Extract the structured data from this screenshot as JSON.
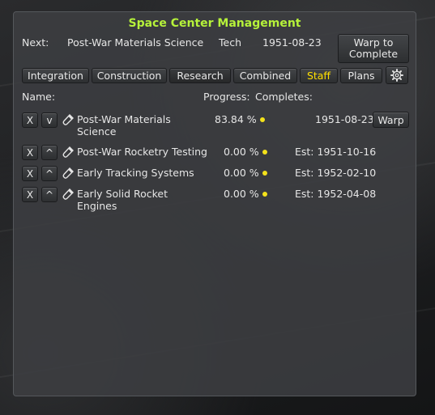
{
  "window": {
    "title": "Space Center Management"
  },
  "next": {
    "label": "Next:",
    "name": "Post-War Materials Science",
    "type": "Tech",
    "date": "1951-08-23",
    "warp_label": "Warp to Complete"
  },
  "tabs": [
    {
      "label": "Integration"
    },
    {
      "label": "Construction"
    },
    {
      "label": "Research"
    },
    {
      "label": "Combined"
    },
    {
      "label": "Staff"
    },
    {
      "label": "Plans"
    }
  ],
  "columns": {
    "name": "Name:",
    "progress": "Progress:",
    "completes": "Completes:"
  },
  "rows": [
    {
      "remove": "X",
      "move": "v",
      "name": "Post-War Materials Science",
      "progress": "83.84 %",
      "completes": "1951-08-23",
      "warp": "Warp"
    },
    {
      "remove": "X",
      "move": "^",
      "name": "Post-War Rocketry Testing",
      "progress": "0.00 %",
      "completes": "Est: 1951-10-16"
    },
    {
      "remove": "X",
      "move": "^",
      "name": "Early Tracking Systems",
      "progress": "0.00 %",
      "completes": "Est: 1952-02-10"
    },
    {
      "remove": "X",
      "move": "^",
      "name": "Early Solid Rocket Engines",
      "progress": "0.00 %",
      "completes": "Est: 1952-04-08"
    }
  ],
  "colors": {
    "title": "#b6f23a",
    "active_tab_text": "#ffe000",
    "status_dot": "#f4e21a"
  },
  "icons": {
    "settings": "gear-icon",
    "research_item": "flask-icon"
  }
}
